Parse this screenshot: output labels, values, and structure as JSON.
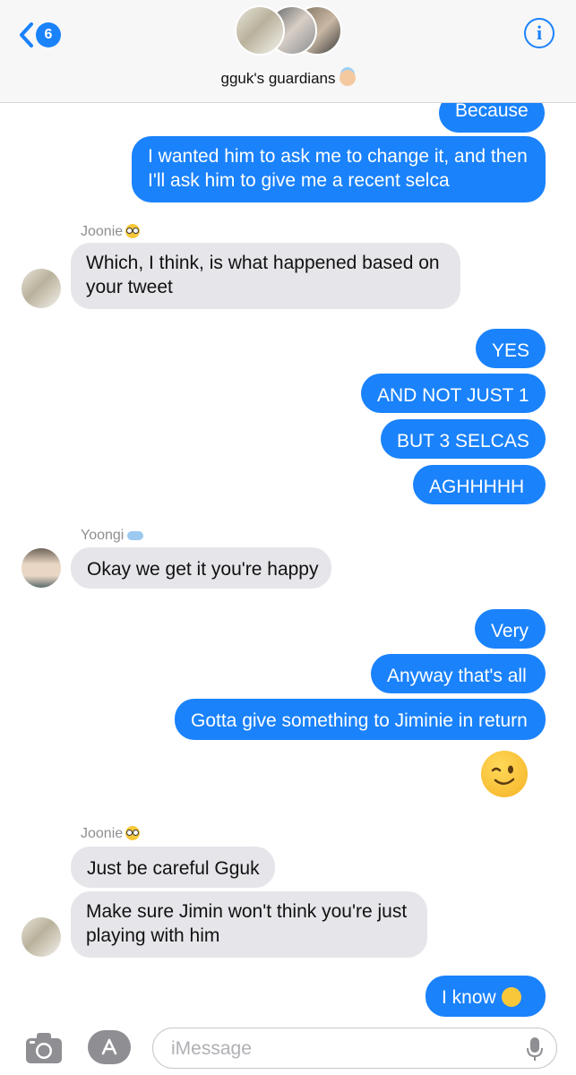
{
  "header": {
    "back_count": "6",
    "group_name": "gguk's guardians",
    "info_label": "i"
  },
  "messages": {
    "m1": "Because",
    "m2a": "I wanted him to ask me to change it, and then",
    "m2b": "I'll ask him to give me a recent selca",
    "sender1": "Joonie",
    "m3a": "Which, I think, is what happened based on",
    "m3b": "your tweet",
    "m4": "YES",
    "m5": "AND NOT JUST 1",
    "m6": "BUT 3 SELCAS",
    "m7": "AGHHHHH",
    "sender2": "Yoongi",
    "m8": "Okay we get it you're happy",
    "m9": "Very",
    "m10": "Anyway that's all",
    "m11": "Gotta give something to Jiminie in return",
    "sender3": "Joonie",
    "m12": "Just be careful Gguk",
    "m13a": "Make sure Jimin won't think you're just",
    "m13b": "playing with him",
    "m14": "I know"
  },
  "input": {
    "placeholder": "iMessage"
  },
  "colors": {
    "outgoing": "#1a82fb",
    "incoming": "#e5e5ea",
    "accent": "#1a82fb"
  },
  "icons": [
    "back-chevron-icon",
    "info-icon",
    "camera-icon",
    "app-store-icon",
    "microphone-icon",
    "wink-emoji",
    "grin-emoji",
    "nerd-emoji",
    "cloud-emoji",
    "angel-emoji"
  ]
}
